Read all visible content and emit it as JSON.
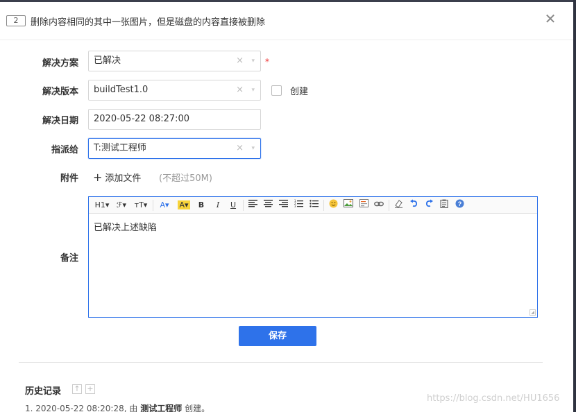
{
  "dialog": {
    "id_badge": "2",
    "title": "删除内容相同的其中一张图片，但是磁盘的内容直接被删除",
    "close_glyph": "✕"
  },
  "form": {
    "resolution": {
      "label": "解决方案",
      "value": "已解决",
      "required_mark": "*"
    },
    "build": {
      "label": "解决版本",
      "value": "buildTest1.0",
      "checkbox_label": "创建"
    },
    "date": {
      "label": "解决日期",
      "value": "2020-05-22 08:27:00"
    },
    "assign": {
      "label": "指派给",
      "value": "T:测试工程师"
    },
    "attachment": {
      "label": "附件",
      "add_label": "添加文件",
      "hint": "(不超过50M)"
    },
    "notes": {
      "label": "备注",
      "content": "已解决上述缺陷"
    }
  },
  "select_glyphs": {
    "clear": "×",
    "caret": "▾"
  },
  "toolbar": {
    "h1": "H1▾",
    "font": "ℱ▾",
    "size": "тT▾",
    "fore_color": "A▾",
    "back_color": "A▾",
    "bold": "B",
    "italic": "I",
    "underline": "U",
    "icons": [
      "align-left-icon",
      "align-center-icon",
      "align-right-icon",
      "ordered-list-icon",
      "unordered-list-icon",
      "emoji-icon",
      "image-icon",
      "code-icon",
      "link-icon",
      "eraser-icon",
      "undo-icon",
      "redo-icon",
      "paste-icon",
      "help-icon"
    ]
  },
  "save_label": "保存",
  "history": {
    "title": "历史记录",
    "entry_num": "1.",
    "entry_time": "2020-05-22 08:20:28,",
    "entry_by": "由",
    "entry_user": "测试工程师",
    "entry_action": "创建。"
  },
  "watermark": "https://blog.csdn.net/HU1656",
  "colors": {
    "accent": "#2e72ea",
    "required": "#ee3333"
  }
}
